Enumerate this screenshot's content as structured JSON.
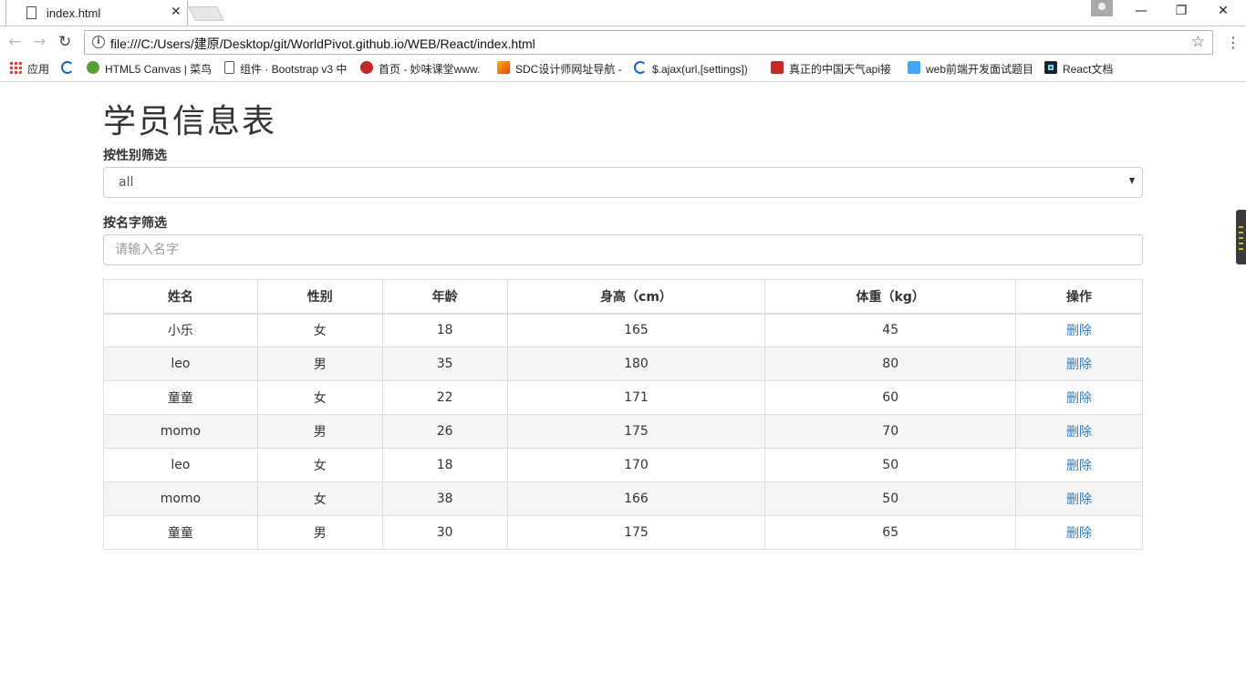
{
  "browser": {
    "tab_title": "index.html",
    "url": "file:///C:/Users/建原/Desktop/git/WorldPivot.github.io/WEB/React/index.html",
    "bookmarks": [
      {
        "label": "应用",
        "icon": "apps-grid-icon",
        "color": "#e53935"
      },
      {
        "label": "",
        "icon": "w3-swirl-icon",
        "color": "#1565c0"
      },
      {
        "label": "HTML5 Canvas | 菜鸟",
        "icon": "runoob-icon",
        "color": "#5a9e3a"
      },
      {
        "label": "组件 · Bootstrap v3 中",
        "icon": "page-icon",
        "color": "#ffffff"
      },
      {
        "label": "首页 - 妙味课堂www.",
        "icon": "miaov-icon",
        "color": "#c62828"
      },
      {
        "label": "SDC设计师网址导航 -",
        "icon": "sdc-icon",
        "color": "#d84315"
      },
      {
        "label": "$.ajax(url,[settings])",
        "icon": "jquery-swirl-icon",
        "color": "#1565c0"
      },
      {
        "label": "真正的中国天气api接",
        "icon": "c-logo-icon",
        "color": "#c62828"
      },
      {
        "label": "web前端开发面试题目",
        "icon": "a-logo-icon",
        "color": "#42a5f5"
      },
      {
        "label": "React文档",
        "icon": "react-icon",
        "color": "#222222"
      }
    ]
  },
  "page": {
    "title": "学员信息表",
    "gender_filter_label": "按性别筛选",
    "gender_selected": "all",
    "name_filter_label": "按名字筛选",
    "name_placeholder": "请输入名字",
    "table": {
      "headers": [
        "姓名",
        "性别",
        "年龄",
        "身高（cm）",
        "体重（kg）",
        "操作"
      ],
      "rows": [
        [
          "小乐",
          "女",
          "18",
          "165",
          "45",
          "删除"
        ],
        [
          "leo",
          "男",
          "35",
          "180",
          "80",
          "删除"
        ],
        [
          "童童",
          "女",
          "22",
          "171",
          "60",
          "删除"
        ],
        [
          "momo",
          "男",
          "26",
          "175",
          "70",
          "删除"
        ],
        [
          "leo",
          "女",
          "18",
          "170",
          "50",
          "删除"
        ],
        [
          "momo",
          "女",
          "38",
          "166",
          "50",
          "删除"
        ],
        [
          "童童",
          "男",
          "30",
          "175",
          "65",
          "删除"
        ]
      ]
    }
  },
  "colors": {
    "link": "#337ab7",
    "border": "#dddddd",
    "striped_row": "#f5f5f5"
  }
}
